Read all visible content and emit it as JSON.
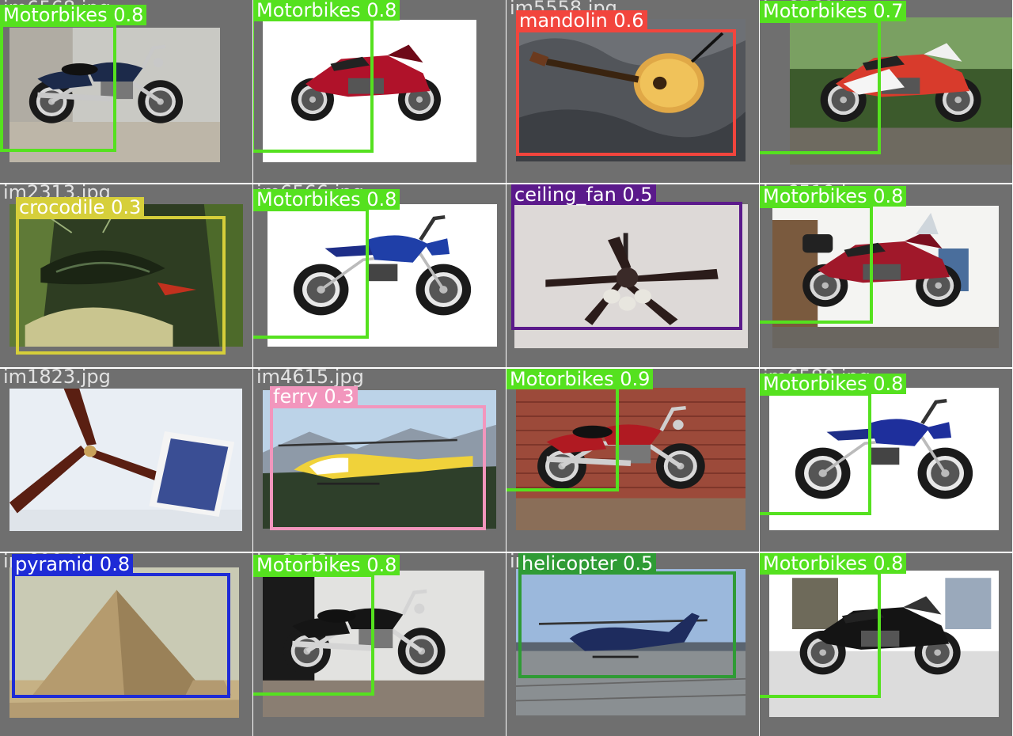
{
  "colors": {
    "motorbike": "#55e11f",
    "mandolin": "#f2453d",
    "crocodile": "#d6cf3a",
    "ceiling_fan": "#5b1a8b",
    "ferry": "#f296bd",
    "pyramid": "#1e2bd6",
    "helicopter": "#2f9b35",
    "tile_bg": "#6f6f6f"
  },
  "tiles": [
    {
      "file": "im6568.jpg",
      "label": "Motorbikes 0.8",
      "class": "motorbike",
      "scene": "cruiser-silver"
    },
    {
      "file": "im6514.jpg",
      "label": "Motorbikes 0.8",
      "class": "motorbike",
      "scene": "sport-red"
    },
    {
      "file": "im5558.jpg",
      "label": "mandolin 0.6",
      "class": "mandolin",
      "scene": "mandolin"
    },
    {
      "file": "im6561.jpg",
      "label": "Motorbikes 0.7",
      "class": "motorbike",
      "scene": "sport-yamaha"
    },
    {
      "file": "im2313.jpg",
      "label": "crocodile 0.3",
      "class": "crocodile",
      "scene": "crayfish"
    },
    {
      "file": "im6566.jpg",
      "label": "Motorbikes 0.8",
      "class": "motorbike",
      "scene": "dirt-blue"
    },
    {
      "file": "im1825.jpg",
      "label": "ceiling_fan 0.5",
      "class": "ceiling_fan",
      "scene": "ceiling-fan"
    },
    {
      "file": "im6519.jpg",
      "label": "Motorbikes 0.8",
      "class": "motorbike",
      "scene": "touring-garage"
    },
    {
      "file": "im1823.jpg",
      "label": "",
      "class": "",
      "scene": "fan-solar"
    },
    {
      "file": "im4615.jpg",
      "label": "ferry 0.3",
      "class": "ferry",
      "scene": "helicopter-yellow"
    },
    {
      "file": "im6557.jpg",
      "label": "Motorbikes 0.9",
      "class": "motorbike",
      "scene": "cruiser-brick"
    },
    {
      "file": "im6588.jpg",
      "label": "Motorbikes 0.8",
      "class": "motorbike",
      "scene": "dirt-yamaha"
    },
    {
      "file": "im6994.jpg",
      "label": "pyramid 0.8",
      "class": "pyramid",
      "scene": "pyramid"
    },
    {
      "file": "im6539.jpg",
      "label": "Motorbikes 0.8",
      "class": "motorbike",
      "scene": "cruiser-garage"
    },
    {
      "file": "im4607.jpg",
      "label": "helicopter 0.5",
      "class": "helicopter",
      "scene": "helicopter-blue"
    },
    {
      "file": "im6585.jpg",
      "label": "Motorbikes 0.8",
      "class": "motorbike",
      "scene": "naked-black"
    }
  ]
}
